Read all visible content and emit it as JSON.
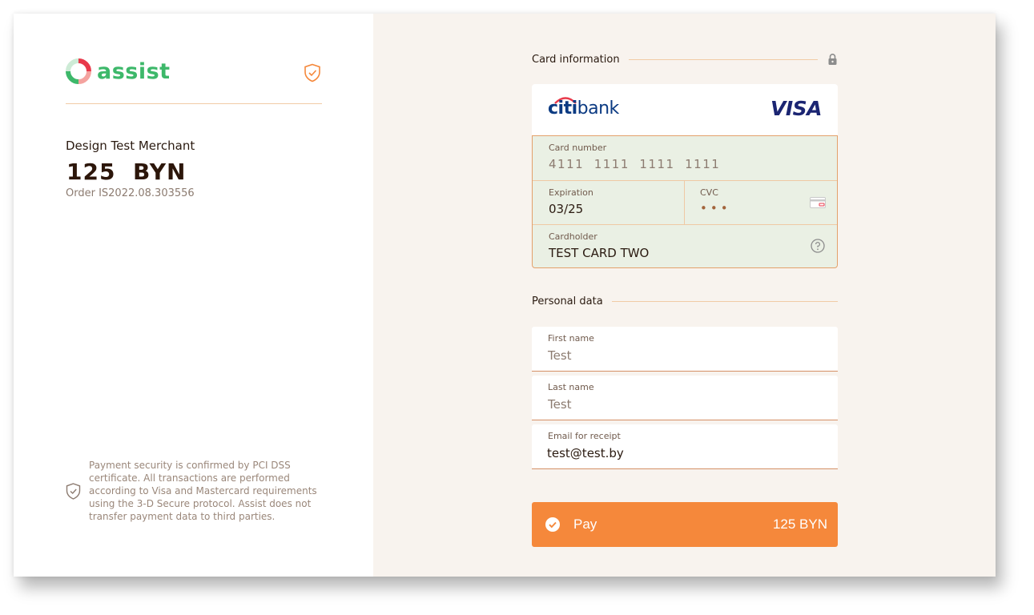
{
  "brand": {
    "name": "assist",
    "accent": "#3db86a",
    "mark_colors": [
      "#e8394a",
      "#3db86a"
    ]
  },
  "order": {
    "merchant": "Design Test Merchant",
    "amount": "125  BYN",
    "order_number": "Order IS2022.08.303556"
  },
  "security_note": "Payment security is confirmed by PCI DSS certificate. All transactions are performed according to Visa and Mastercard requirements using the 3-D Secure protocol. Assist does not transfer payment data to third parties.",
  "card_section": {
    "title": "Card information",
    "bank_logo": {
      "part1": "citi",
      "part2": "bank"
    },
    "network": "VISA",
    "fields": {
      "card_number": {
        "label": "Card number",
        "value": "4111  1111  1111  1111"
      },
      "expiration": {
        "label": "Expiration",
        "value": "03/25"
      },
      "cvc": {
        "label": "CVC",
        "value": "•••"
      },
      "cardholder": {
        "label": "Cardholder",
        "value": "TEST CARD TWO"
      }
    }
  },
  "personal_section": {
    "title": "Personal data",
    "fields": {
      "first_name": {
        "label": "First name",
        "value": "Test"
      },
      "last_name": {
        "label": "Last name",
        "value": "Test"
      },
      "email": {
        "label": "Email for receipt",
        "value": "test@test.by"
      }
    }
  },
  "pay_button": {
    "label": "Pay",
    "amount": "125 BYN",
    "color": "#f5883b"
  },
  "icons": [
    "shield-check-icon",
    "lock-icon",
    "card-icon",
    "help-icon",
    "check-circle-icon"
  ]
}
